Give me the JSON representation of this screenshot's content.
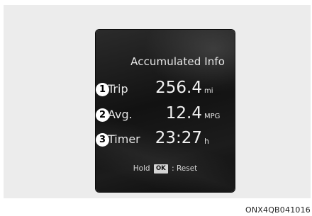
{
  "screen": {
    "title": "Accumulated Info",
    "items": [
      {
        "badge": "1",
        "label": "Trip",
        "value": "256.4",
        "unit": "mi"
      },
      {
        "badge": "2",
        "label": "Avg.",
        "value": "12.4",
        "unit": "MPG"
      },
      {
        "badge": "3",
        "label": "Timer",
        "value": "23:27",
        "unit": "h"
      }
    ],
    "hint": {
      "hold": "Hold",
      "key": "OK",
      "action": ": Reset"
    }
  },
  "figure_code": "ONX4QB041016",
  "colors": {
    "screen_bg": "#141414",
    "badge_bg": "#ffffff",
    "panel_bg": "#ececec"
  }
}
